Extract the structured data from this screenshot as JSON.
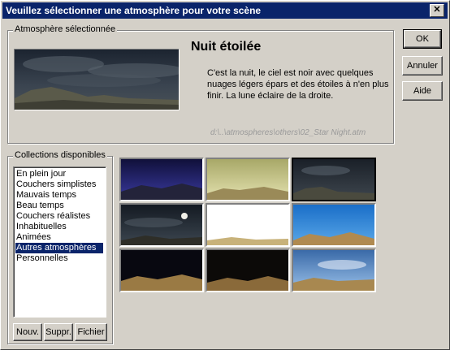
{
  "dialog": {
    "title": "Veuillez sélectionner une atmosphère pour votre scène",
    "close_glyph": "✕"
  },
  "selected": {
    "legend": "Atmosphère sélectionnée",
    "name": "Nuit étoilée",
    "description": "C'est la nuit, le ciel est noir avec quelques nuages légers épars et des étoiles à n'en plus finir. La lune éclaire de la droite.",
    "path": "d:\\..\\atmospheres\\others\\02_Star Night.atm"
  },
  "buttons": {
    "ok": "OK",
    "cancel": "Annuler",
    "help": "Aide",
    "new": "Nouv.",
    "delete": "Suppr.",
    "file": "Fichier"
  },
  "collections": {
    "legend": "Collections disponibles",
    "items": [
      "En plein jour",
      "Couchers simplistes",
      "Mauvais temps",
      "Beau temps",
      "Couchers réalistes",
      "Inhabituelles",
      "Animées",
      "Autres atmosphères",
      "Personnelles"
    ],
    "selected_item": "Autres atmosphères"
  },
  "thumbnails_selected_index": 2
}
